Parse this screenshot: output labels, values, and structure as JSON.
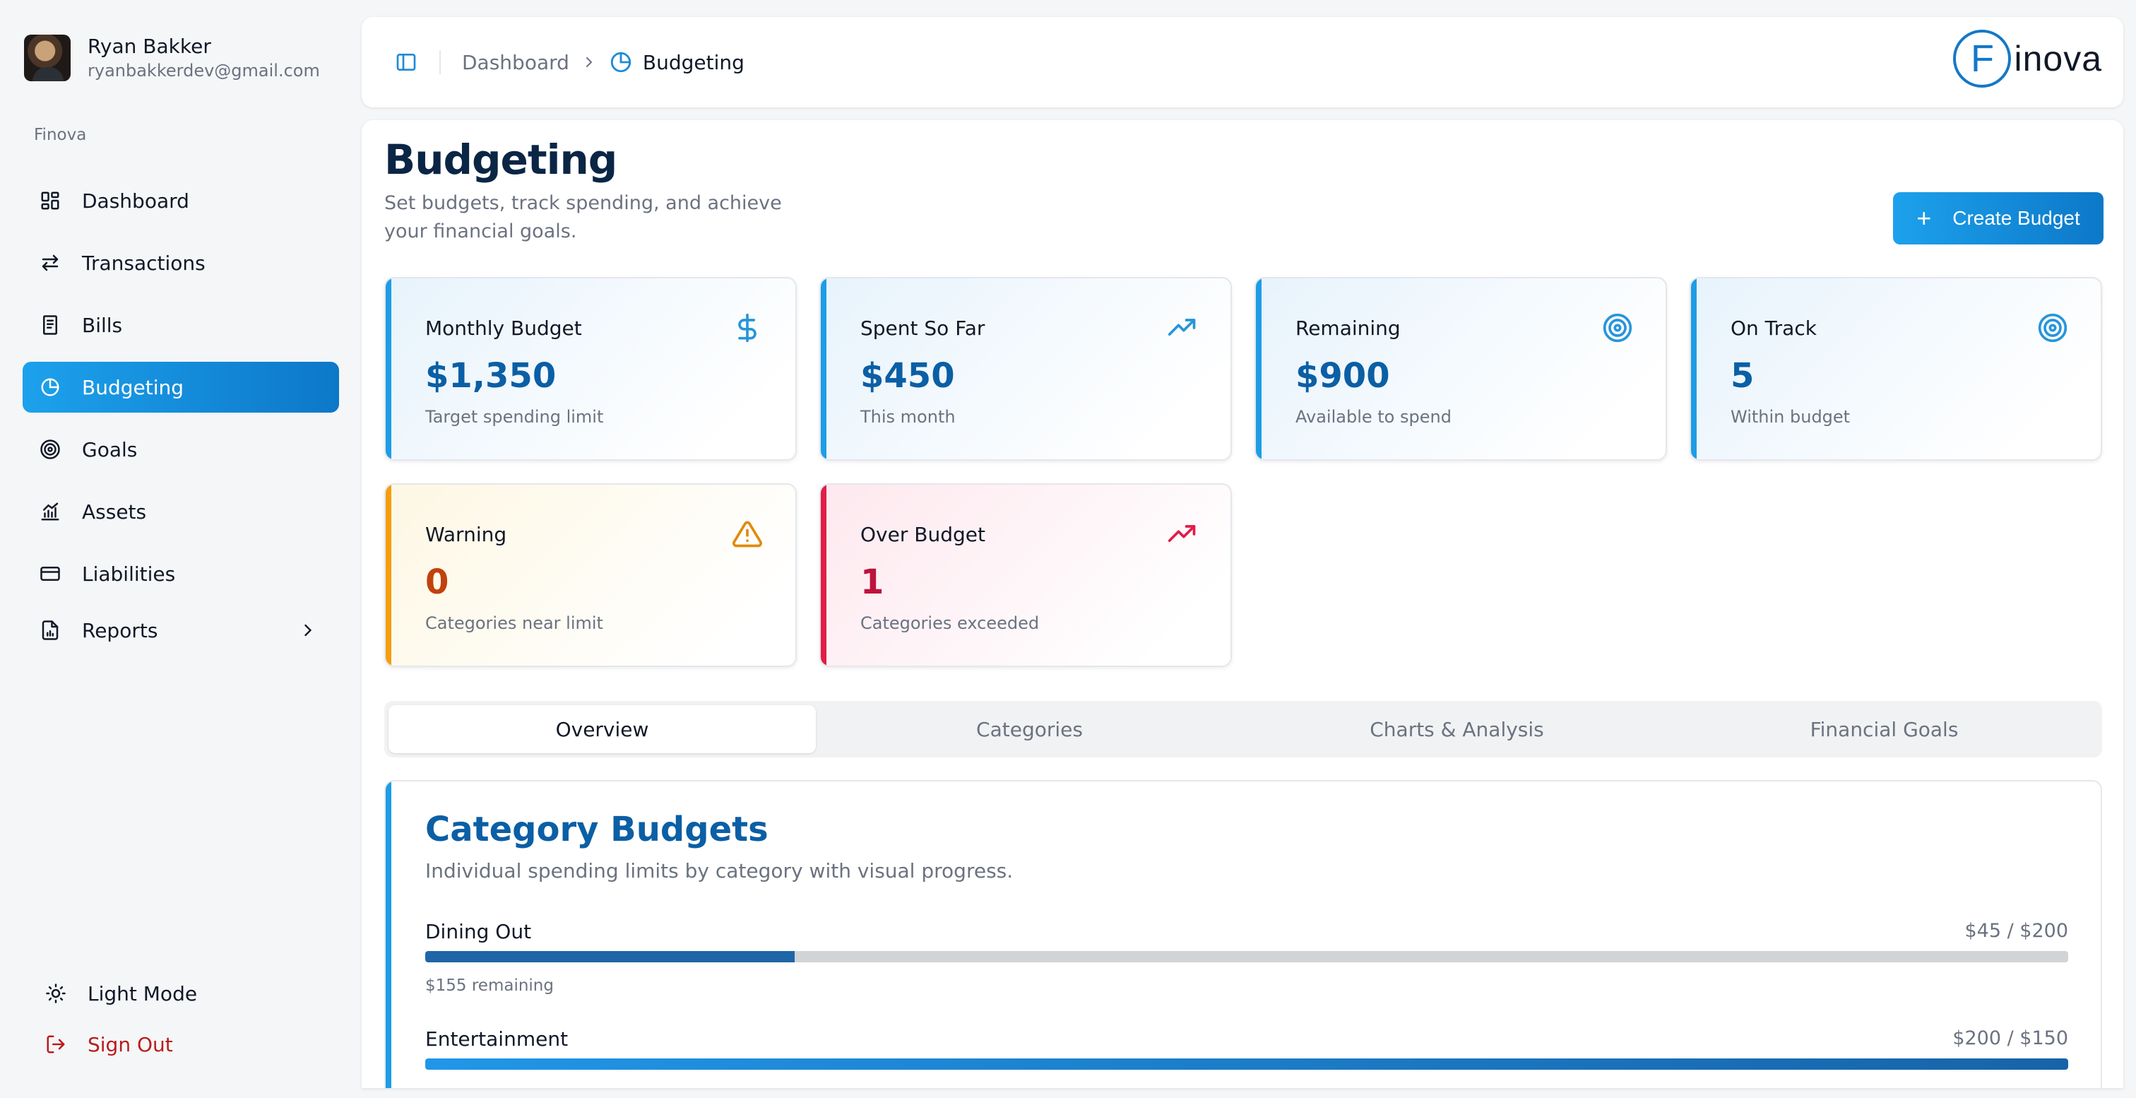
{
  "user": {
    "name": "Ryan Bakker",
    "email": "ryanbakkerdev@gmail.com"
  },
  "sidebar": {
    "section_label": "Finova",
    "items": [
      {
        "label": "Dashboard",
        "icon": "dashboard-grid-icon"
      },
      {
        "label": "Transactions",
        "icon": "arrows-swap-icon"
      },
      {
        "label": "Bills",
        "icon": "receipt-icon"
      },
      {
        "label": "Budgeting",
        "icon": "pie-chart-icon",
        "active": true
      },
      {
        "label": "Goals",
        "icon": "target-icon"
      },
      {
        "label": "Assets",
        "icon": "bar-chart-icon"
      },
      {
        "label": "Liabilities",
        "icon": "credit-card-icon"
      },
      {
        "label": "Reports",
        "icon": "report-file-icon",
        "expandable": true
      }
    ],
    "light_mode_label": "Light Mode",
    "sign_out_label": "Sign Out"
  },
  "header": {
    "breadcrumb_home": "Dashboard",
    "breadcrumb_current": "Budgeting",
    "logo_letter": "F",
    "logo_text": "inova"
  },
  "page": {
    "title": "Budgeting",
    "subtitle": "Set budgets, track spending, and achieve your financial goals.",
    "create_button": "Create Budget"
  },
  "cards": [
    {
      "title": "Monthly Budget",
      "value": "$1,350",
      "caption": "Target spending limit",
      "icon": "dollar-icon",
      "theme": "blue"
    },
    {
      "title": "Spent So Far",
      "value": "$450",
      "caption": "This month",
      "icon": "trending-up-icon",
      "theme": "blue"
    },
    {
      "title": "Remaining",
      "value": "$900",
      "caption": "Available to spend",
      "icon": "target-icon",
      "theme": "blue"
    },
    {
      "title": "On Track",
      "value": "5",
      "caption": "Within budget",
      "icon": "target-icon",
      "theme": "blue"
    },
    {
      "title": "Warning",
      "value": "0",
      "caption": "Categories near limit",
      "icon": "warning-triangle-icon",
      "theme": "orange"
    },
    {
      "title": "Over Budget",
      "value": "1",
      "caption": "Categories exceeded",
      "icon": "trending-up-icon",
      "theme": "red"
    }
  ],
  "tabs": [
    {
      "label": "Overview",
      "active": true
    },
    {
      "label": "Categories"
    },
    {
      "label": "Charts & Analysis"
    },
    {
      "label": "Financial Goals"
    }
  ],
  "category_budgets": {
    "title": "Category Budgets",
    "subtitle": "Individual spending limits by category with visual progress.",
    "rows": [
      {
        "name": "Dining Out",
        "amount": "$45 / $200",
        "progress": 0.225,
        "remaining": "$155 remaining",
        "over": false
      },
      {
        "name": "Entertainment",
        "amount": "$200 / $150",
        "progress": 1.0,
        "remaining": "",
        "over": true
      }
    ]
  },
  "colors": {
    "accent": "#1d9de6",
    "accent_dark": "#0c78c8",
    "value_blue": "#0b5fa5",
    "warning": "#f59e0b",
    "danger": "#e11d48",
    "sign_out": "#b91c1c"
  }
}
